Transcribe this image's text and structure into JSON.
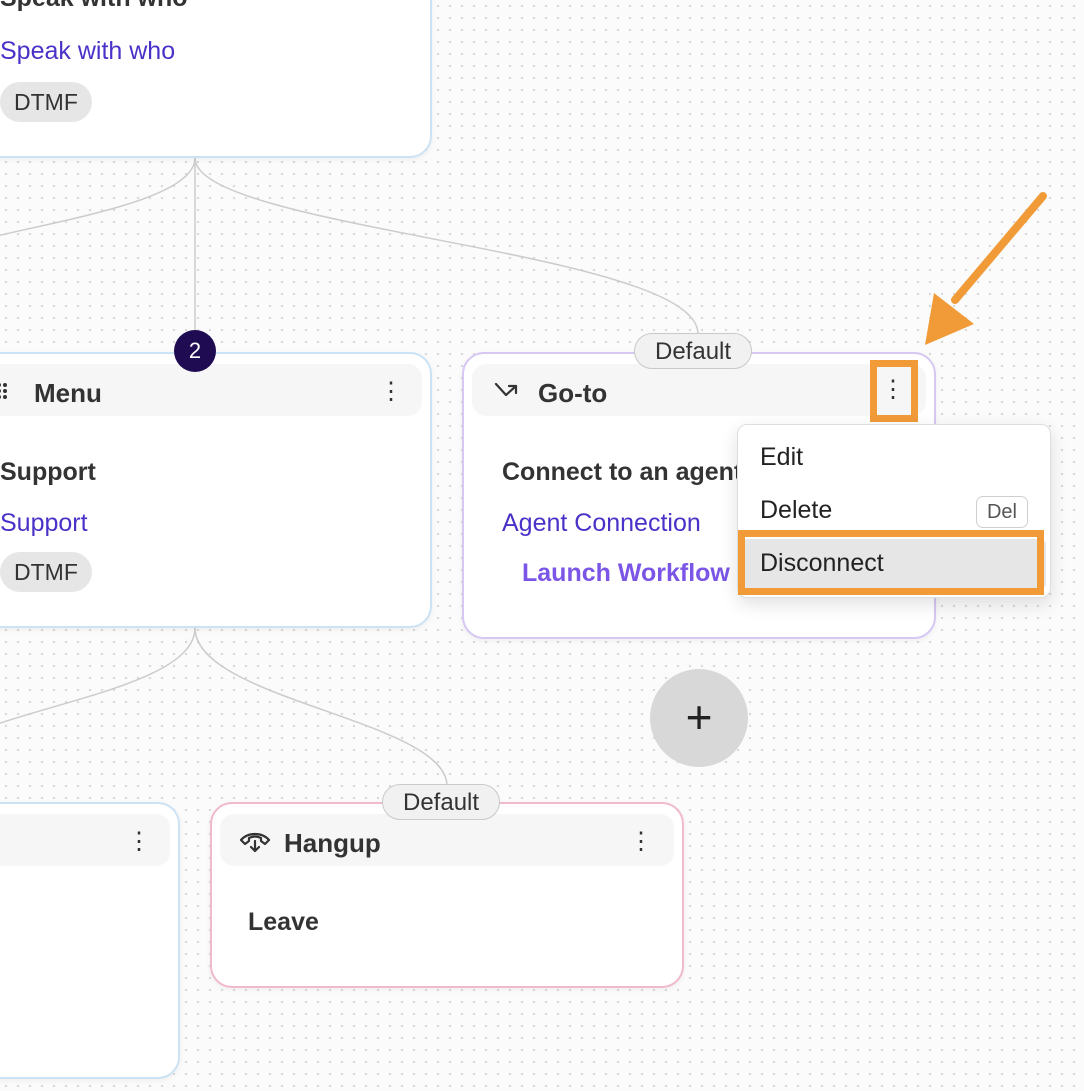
{
  "colors": {
    "accent_link": "#4a32c8",
    "launch_link": "#7a55e6",
    "annotation_orange": "#f09a38",
    "badge_bg": "#1e0b52"
  },
  "top_node": {
    "title": "Speak with who",
    "link": "Speak with who",
    "chip": "DTMF"
  },
  "menu_node": {
    "icon": "grid-dots-icon",
    "title": "Menu",
    "badge": "2",
    "text": "Support",
    "link": "Support",
    "chip": "DTMF"
  },
  "goto_node": {
    "icon": "goto-arrow-icon",
    "title": "Go-to",
    "pill": "Default",
    "text": "Connect to an agent",
    "link": "Agent Connection",
    "sublink": "Launch Workflow"
  },
  "hangup_node": {
    "icon": "phone-hangup-icon",
    "title": "Hangup",
    "pill": "Default",
    "text": "Leave"
  },
  "context_menu": {
    "items": [
      {
        "label": "Edit",
        "shortcut": ""
      },
      {
        "label": "Delete",
        "shortcut": "Del"
      },
      {
        "label": "Disconnect",
        "shortcut": ""
      }
    ],
    "highlighted": "Disconnect"
  },
  "add_button": {
    "label": "+"
  }
}
